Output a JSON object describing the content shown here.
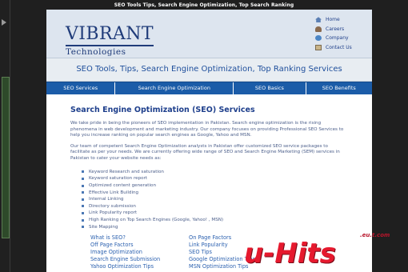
{
  "caption": "SEO Tools Tips, Search Engine Optimization, Top Search Ranking",
  "header": {
    "logo_name": "VIBRANT",
    "logo_sub": "Technologies",
    "links": [
      {
        "label": "Home",
        "icon": "home-icon"
      },
      {
        "label": "Careers",
        "icon": "careers-icon"
      },
      {
        "label": "Company",
        "icon": "company-icon"
      },
      {
        "label": "Contact Us",
        "icon": "contact-icon"
      }
    ]
  },
  "tagline": "SEO Tools, Tips, Search Engine Optimization, Top Ranking Services",
  "nav": [
    "SEO Services",
    "Search Engine Optimization",
    "SEO Basics",
    "SEO Benefits"
  ],
  "content": {
    "title": "Search Engine Optimization (SEO) Services",
    "para1": "We take pride in being the pioneers of SEO implementation in Pakistan. Search engine optimization is the rising phenomena in web development and marketing industry. Our company focuses on providing Professional SEO Services to help you increase ranking on popular search engines as Google, Yahoo and MSN.",
    "para2": "Our team of competent Search Engine Optimization analysts in Pakistan offer customized SEO service packages to facilitate as per your needs. We are currently offering wide range of SEO and Search Engine Marketing (SEM) services in Pakistan to cater your website needs as:",
    "services": [
      "Keyword Research and saturation",
      "Keyword saturation report",
      "Optimized content generation",
      "Effective Link Building",
      "Internal Linking",
      "Directory submission",
      "Link Popularity report",
      "High Ranking on Top Search Engines (Google, Yahoo! , MSN)",
      "Site Mapping"
    ],
    "links_left": [
      "What is SEO?",
      "Off Page Factors",
      "Image Optimization",
      "Search Engine Submission",
      "Yahoo Optimization Tips"
    ],
    "links_right": [
      "On Page Factors",
      "Link Popularity",
      "SEO Tips",
      "Google Optimization Tips",
      "MSN Optimization Tips"
    ]
  },
  "watermark": {
    "site": ".eu.t.com",
    "brand": "u-Hits"
  }
}
